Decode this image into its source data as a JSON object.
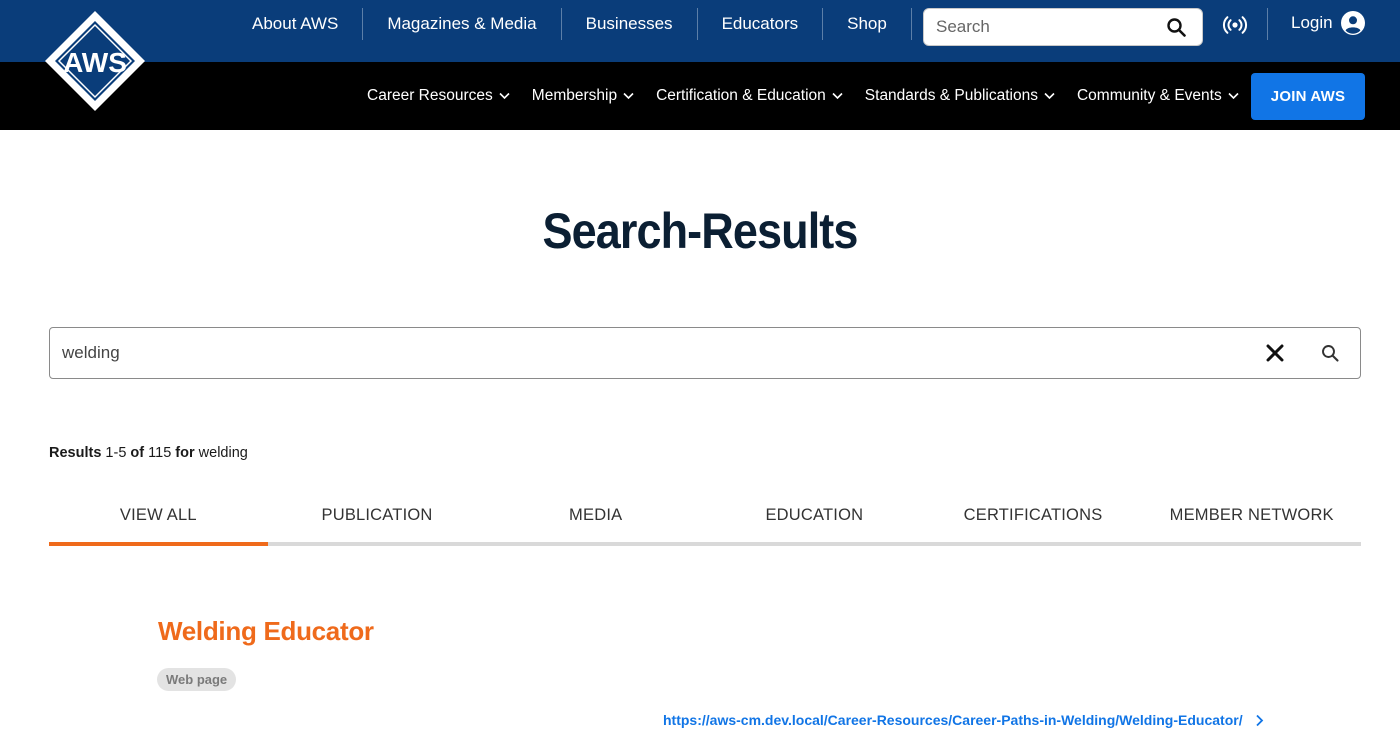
{
  "brand": {
    "logo_text": "AWS",
    "primary_color": "#0a3d7a",
    "accent_color": "#ef6a1b",
    "link_color": "#1175e6"
  },
  "top_nav": {
    "items": [
      {
        "label": "About AWS"
      },
      {
        "label": "Magazines & Media"
      },
      {
        "label": "Businesses"
      },
      {
        "label": "Educators"
      },
      {
        "label": "Shop"
      }
    ],
    "search_placeholder": "Search",
    "search_icon": "search-icon",
    "podcast_icon": "podcast-icon",
    "login_label": "Login",
    "login_icon": "user-circle-icon"
  },
  "main_nav": {
    "items": [
      {
        "label": "Career Resources"
      },
      {
        "label": "Membership"
      },
      {
        "label": "Certification & Education"
      },
      {
        "label": "Standards & Publications"
      },
      {
        "label": "Community & Events"
      }
    ],
    "join_label": "JOIN AWS"
  },
  "page": {
    "title": "Search-Results"
  },
  "search": {
    "value": "welding",
    "clear_icon": "close-icon",
    "submit_icon": "search-icon"
  },
  "results_summary": {
    "prefix": "Results",
    "range": "1-5",
    "of_label": "of",
    "total": "115",
    "for_label": "for",
    "query": "welding"
  },
  "tabs": [
    {
      "label": "VIEW ALL",
      "active": true
    },
    {
      "label": "PUBLICATION",
      "active": false
    },
    {
      "label": "MEDIA",
      "active": false
    },
    {
      "label": "EDUCATION",
      "active": false
    },
    {
      "label": "CERTIFICATIONS",
      "active": false
    },
    {
      "label": "MEMBER NETWORK",
      "active": false
    }
  ],
  "results": [
    {
      "title": "Welding Educator",
      "type_badge": "Web page",
      "url": "https://aws-cm.dev.local/Career-Resources/Career-Paths-in-Welding/Welding-Educator/"
    }
  ]
}
